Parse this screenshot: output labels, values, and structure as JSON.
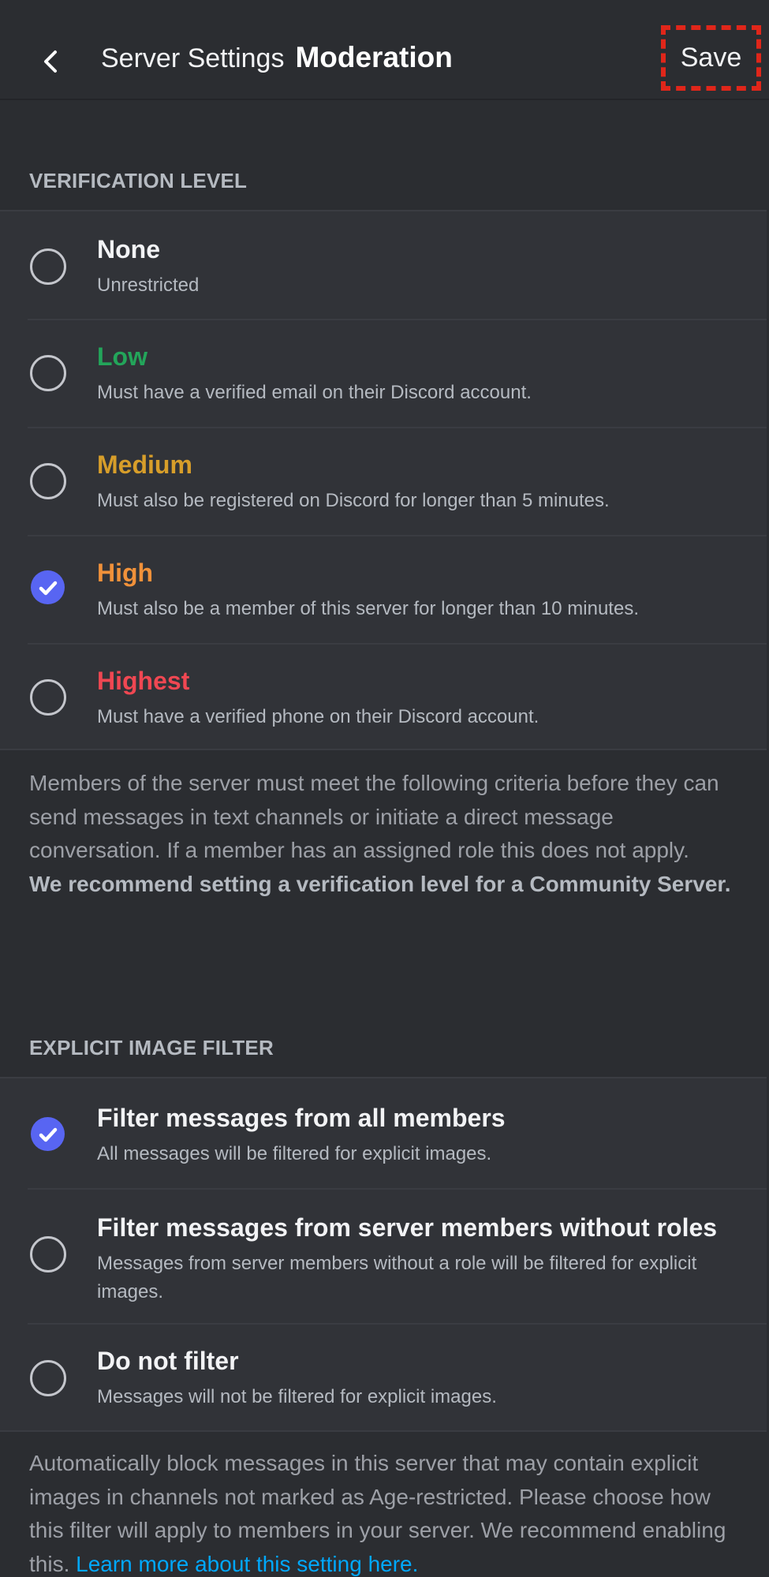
{
  "header": {
    "back_icon": "chevron-left-icon",
    "title_prefix": "Server Settings",
    "title": "Moderation",
    "save_label": "Save",
    "save_highlight_color": "#e0261a"
  },
  "verification": {
    "section_label": "VERIFICATION LEVEL",
    "selected": "High",
    "options": [
      {
        "label": "None",
        "description": "Unrestricted",
        "color": "#f2f3f5",
        "checked": false
      },
      {
        "label": "Low",
        "description": "Must have a verified email on their Discord account.",
        "color": "#23a55a",
        "checked": false
      },
      {
        "label": "Medium",
        "description": "Must also be registered on Discord for longer than 5 minutes.",
        "color": "#d79e2a",
        "checked": false
      },
      {
        "label": "High",
        "description": "Must also be a member of this server for longer than 10 minutes.",
        "color": "#f0913a",
        "checked": true
      },
      {
        "label": "Highest",
        "description": "Must have a verified phone on their Discord account.",
        "color": "#f04752",
        "checked": false
      }
    ],
    "note": "Members of the server must meet the following criteria before they can send messages in text channels or initiate a direct message conversation. If a member has an assigned role this does not apply.",
    "note_bold": "We recommend setting a verification level for a Community Server."
  },
  "explicit_filter": {
    "section_label": "EXPLICIT IMAGE FILTER",
    "selected": "Filter messages from all members",
    "options": [
      {
        "label": "Filter messages from all members",
        "description": "All messages will be filtered for explicit images.",
        "checked": true
      },
      {
        "label": "Filter messages from server members without roles",
        "description": "Messages from server members without a role will be filtered for explicit images.",
        "checked": false
      },
      {
        "label": "Do not filter",
        "description": "Messages will not be filtered for explicit images.",
        "checked": false
      }
    ],
    "note": "Automatically block messages in this server that may contain explicit images in channels not marked as Age-restricted. Please choose how this filter will apply to members in your server. We recommend enabling this.",
    "link_text": "Learn more about this setting here."
  },
  "colors": {
    "accent": "#5865f2",
    "link": "#00a8fc",
    "background": "#2b2d31",
    "card": "#313338"
  }
}
